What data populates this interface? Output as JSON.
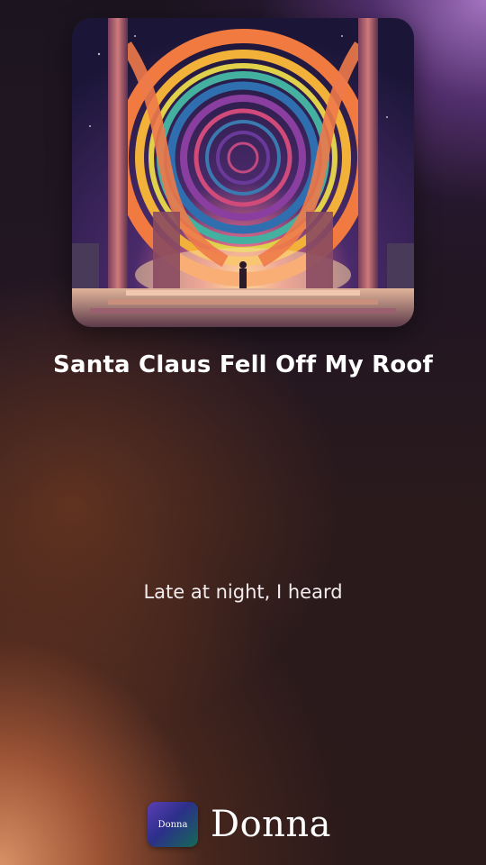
{
  "song": {
    "title": "Santa Claus Fell Off My Roof",
    "cover_art": "album-cover-art"
  },
  "lyrics": {
    "current_line": "Late at night, I heard"
  },
  "brand": {
    "logo_text": "Donna",
    "name": "Donna"
  },
  "colors": {
    "background_dark": "#221622",
    "glow_orange": "#e29669",
    "glow_purple": "#aa78c8",
    "text": "#ffffff"
  }
}
